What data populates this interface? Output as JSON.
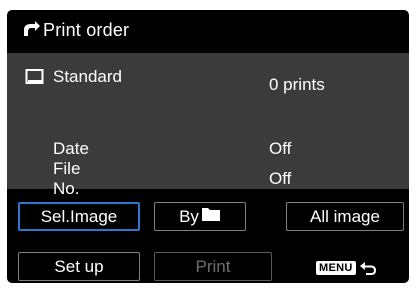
{
  "header": {
    "title": "Print order"
  },
  "panel": {
    "print_type_label": "Standard",
    "print_count": "0 prints",
    "date_label": "Date",
    "date_value": "Off",
    "file_no_label": "File No.",
    "file_no_value": "Off"
  },
  "buttons": {
    "sel_image": "Sel.Image",
    "by_folder": "By",
    "all_image": "All image",
    "set_up": "Set up",
    "print": "Print"
  },
  "footer": {
    "menu_badge": "MENU"
  },
  "icons": {
    "print_order": "printer-icon",
    "standard": "standard-print-icon",
    "folder": "folder-icon",
    "return": "return-icon"
  },
  "colors": {
    "background": "#000000",
    "panel": "#3b3b3b",
    "selected_border": "#2b78d1",
    "disabled_text": "#6e6e6e"
  }
}
